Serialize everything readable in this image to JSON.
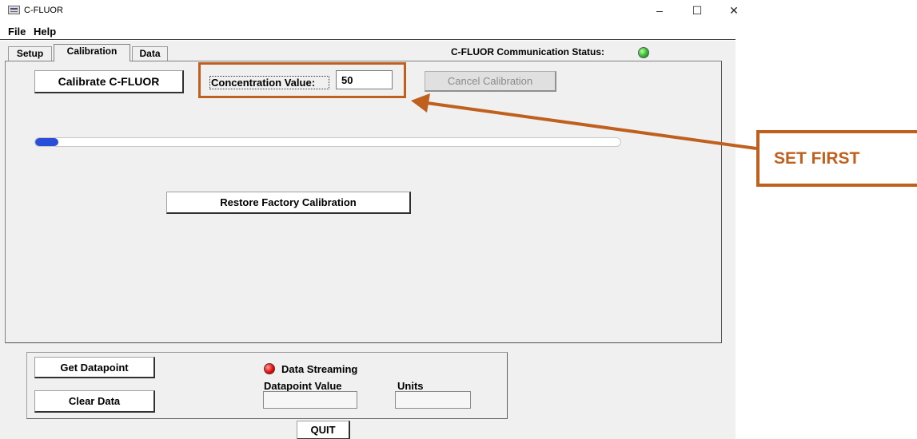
{
  "window": {
    "title": "C-FLUOR",
    "minimize": "–",
    "maximize": "☐",
    "close": "✕"
  },
  "menu": {
    "items": [
      "File",
      "Help"
    ]
  },
  "status": {
    "label": "C-FLUOR Communication Status:",
    "led_color": "#2fb82f"
  },
  "tabs": [
    {
      "label": "Setup",
      "active": false
    },
    {
      "label": "Calibration",
      "active": true
    },
    {
      "label": "Data",
      "active": false
    }
  ],
  "calibration": {
    "calibrate_button": "Calibrate C-FLUOR",
    "concentration_label": "Concentration Value:",
    "concentration_value": "50",
    "cancel_button": "Cancel Calibration",
    "progress_fraction": 0.008,
    "restore_button": "Restore Factory Calibration"
  },
  "annotation": {
    "text": "SET FIRST",
    "color": "#c0601e"
  },
  "bottom": {
    "get_datapoint_button": "Get Datapoint",
    "clear_data_button": "Clear Data",
    "streaming_label": "Data Streaming",
    "streaming_led_color": "#e01010",
    "datapoint_label": "Datapoint Value",
    "datapoint_value": "",
    "units_label": "Units",
    "units_value": "",
    "quit_button": "QUIT"
  }
}
